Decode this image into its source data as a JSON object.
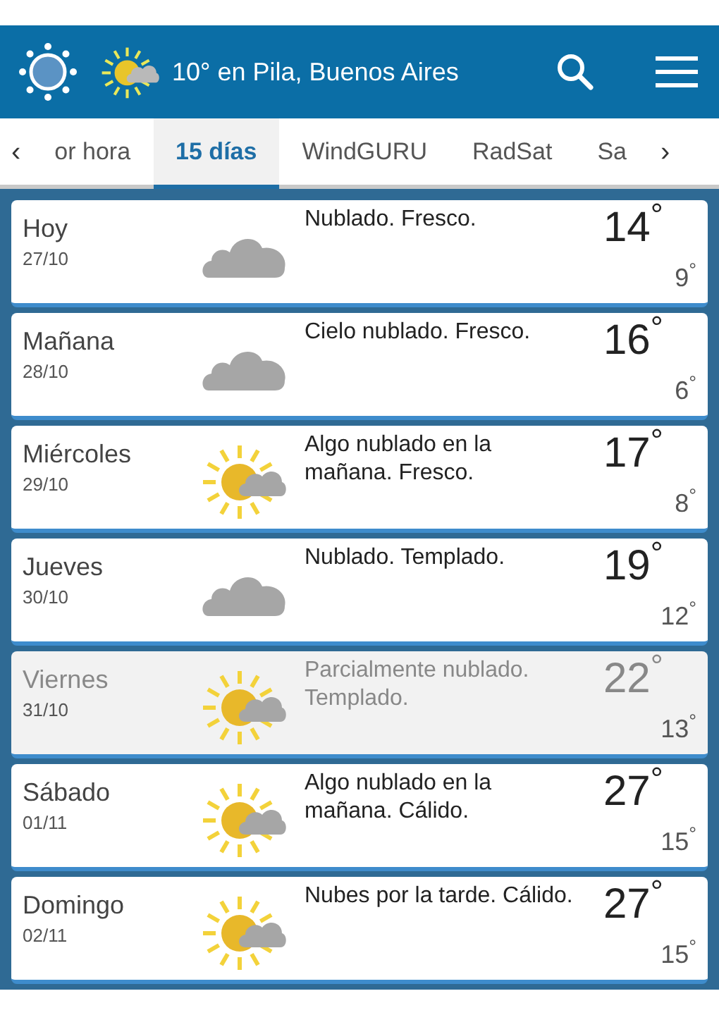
{
  "header": {
    "title": "10° en Pila, Buenos Aires"
  },
  "tabs": [
    {
      "label": "‹",
      "kind": "arrow",
      "selected": false
    },
    {
      "label": "or hora",
      "kind": "tab",
      "selected": false
    },
    {
      "label": "15 días",
      "kind": "tab",
      "selected": true
    },
    {
      "label": "WindGURU",
      "kind": "tab",
      "selected": false
    },
    {
      "label": "RadSat",
      "kind": "tab",
      "selected": false
    },
    {
      "label": "Sa",
      "kind": "tab",
      "selected": false
    },
    {
      "label": "›",
      "kind": "arrow",
      "selected": false
    }
  ],
  "days": [
    {
      "day": "Hoy",
      "date": "27/10",
      "kind": "cloud",
      "description": "Nublado. Fresco.",
      "max": "14$^{°}$",
      "min": "9$^{°}$",
      "dimmed": false
    },
    {
      "day": "Mañana",
      "date": "28/10",
      "kind": "cloud",
      "description": "Cielo nublado. Fresco.",
      "max": "16$^{°}$",
      "min": "6$^{°}$",
      "dimmed": false
    },
    {
      "day": "Miércoles",
      "date": "29/10",
      "kind": "sun-cloud",
      "description": "Algo nublado en la mañana. Fresco.",
      "max": "17$^{°}$",
      "min": "8$^{°}$",
      "dimmed": false
    },
    {
      "day": "Jueves",
      "date": "30/10",
      "kind": "cloud",
      "description": "Nublado. Templado.",
      "max": "19$^{°}$",
      "min": "12$^{°}$",
      "dimmed": false
    },
    {
      "day": "Viernes",
      "date": "31/10",
      "kind": "sun-cloud",
      "description": "Parcialmente nublado. Templado.",
      "max": "22$^{°}$",
      "min": "13$^{°}$",
      "dimmed": true
    },
    {
      "day": "Sábado",
      "date": "01/11",
      "kind": "sun-cloud",
      "description": "Algo nublado en la mañana. Cálido.",
      "max": "27$^{°}$",
      "min": "15$^{°}$",
      "dimmed": false
    },
    {
      "day": "Domingo",
      "date": "02/11",
      "kind": "sun-cloud",
      "description": "Nubes por la tarde. Cálido.",
      "max": "27$^{°}$",
      "min": "15$^{°}$",
      "dimmed": false
    }
  ]
}
